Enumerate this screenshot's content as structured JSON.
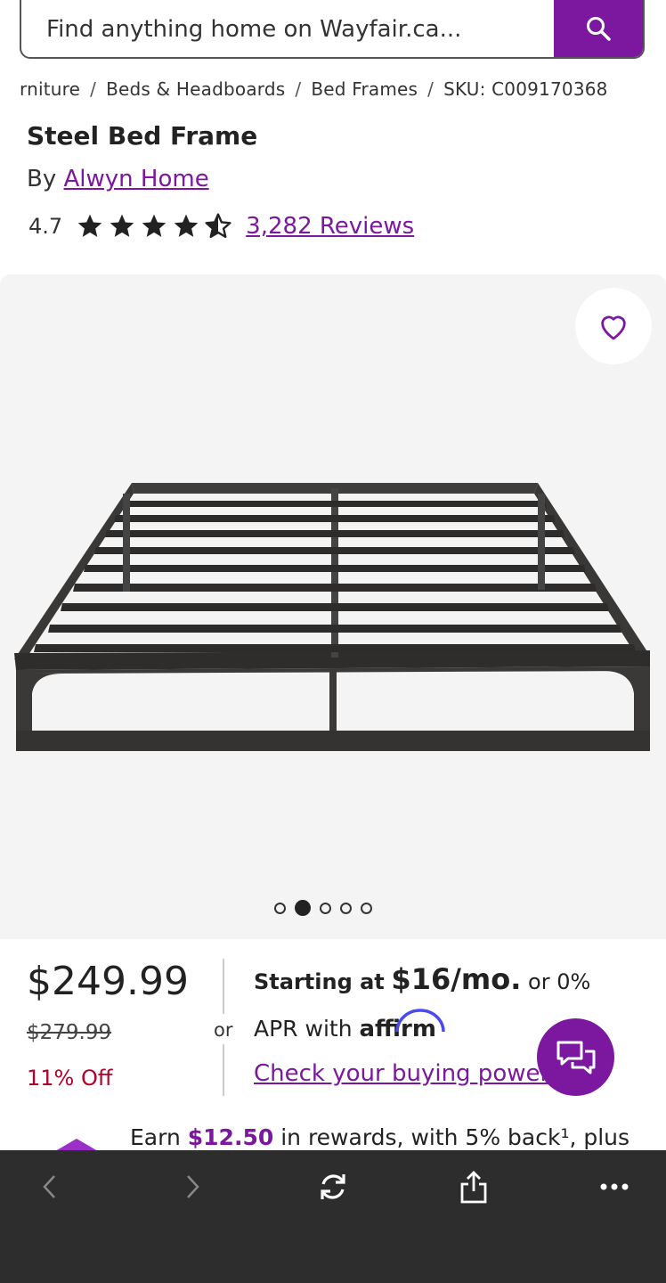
{
  "search": {
    "placeholder": "Find anything home on Wayfair.ca..."
  },
  "breadcrumb": {
    "items": [
      "rniture",
      "Beds & Headboards",
      "Bed Frames",
      "SKU: C009170368"
    ]
  },
  "product": {
    "title": "Steel Bed Frame",
    "by_prefix": "By",
    "brand": "Alwyn Home",
    "rating_value": "4.7",
    "rating_stars": 4.5,
    "reviews_label": "3,282 Reviews"
  },
  "gallery": {
    "image_count": 5,
    "active_index": 1
  },
  "pricing": {
    "price": "$249.99",
    "was_price": "$279.99",
    "discount": "11% Off",
    "or_label": "or",
    "financing_prefix": "Starting at",
    "financing_amount": "$16/mo.",
    "financing_suffix": "or 0%",
    "financing_line2": "APR with",
    "affirm_logo": "affirm",
    "check_link": "Check your buying power"
  },
  "rewards": {
    "prefix": "Earn",
    "amount": "$12.50",
    "text": "in rewards, with 5% back¹, plus"
  },
  "colors": {
    "accent": "#7b189f",
    "discount": "#b3002d",
    "toolbar": "#2d2d2d"
  },
  "icons": [
    "search-icon",
    "heart-icon",
    "chat-icon",
    "back-icon",
    "forward-icon",
    "reload-icon",
    "share-icon",
    "more-icon"
  ]
}
